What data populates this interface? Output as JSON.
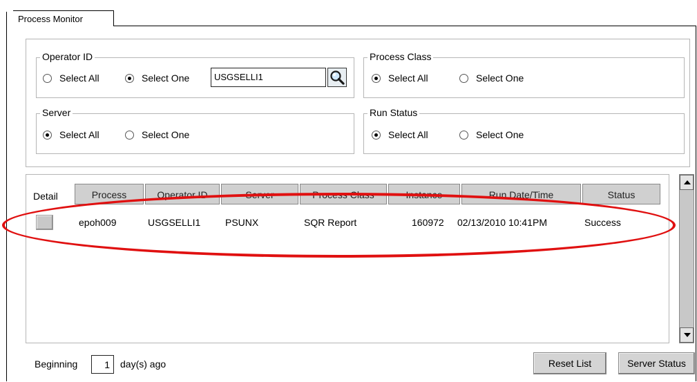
{
  "tab": {
    "label": "Process Monitor"
  },
  "filters": {
    "operator_id": {
      "legend": "Operator ID",
      "select_all": "Select All",
      "select_one": "Select One",
      "value": "USGSELLI1"
    },
    "process_class": {
      "legend": "Process Class",
      "select_all": "Select All",
      "select_one": "Select One"
    },
    "server": {
      "legend": "Server",
      "select_all": "Select All",
      "select_one": "Select One"
    },
    "run_status": {
      "legend": "Run Status",
      "select_all": "Select All",
      "select_one": "Select One"
    }
  },
  "grid": {
    "detail_header": "Detail",
    "columns": [
      "Process",
      "Operator ID",
      "Server",
      "Process Class",
      "Instance",
      "Run Date/Time",
      "Status"
    ],
    "rows": [
      {
        "process": "epoh009",
        "operator_id": "USGSELLI1",
        "server": "PSUNX",
        "process_class": "SQR Report",
        "instance": "160972",
        "run_datetime": "02/13/2010 10:41PM",
        "status": "Success"
      }
    ]
  },
  "footer": {
    "beginning_label": "Beginning",
    "days_value": "1",
    "days_suffix": "day(s) ago",
    "reset_list": "Reset List",
    "server_status": "Server Status"
  },
  "annotation": {
    "color": "#e01010"
  }
}
